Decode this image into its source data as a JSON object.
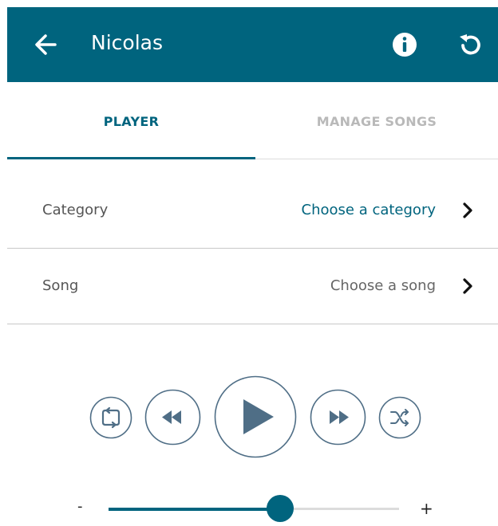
{
  "header": {
    "title": "Nicolas",
    "back_icon": "arrow-left-icon",
    "info_icon": "info-icon",
    "refresh_icon": "refresh-icon"
  },
  "tabs": [
    {
      "label": "PLAYER",
      "active": true
    },
    {
      "label": "MANAGE SONGS",
      "active": false
    }
  ],
  "rows": {
    "category": {
      "label": "Category",
      "value": "Choose a category"
    },
    "song": {
      "label": "Song",
      "value": "Choose a song"
    }
  },
  "controls": {
    "repeat_icon": "repeat-icon",
    "rewind_icon": "rewind-icon",
    "play_icon": "play-icon",
    "forward_icon": "fast-forward-icon",
    "shuffle_icon": "shuffle-icon"
  },
  "volume": {
    "minus_label": "-",
    "plus_label": "+",
    "level": 0.59
  },
  "colors": {
    "primary": "#00647e",
    "control_stroke": "#4f6e86",
    "inactive_tab": "#b9b9b9"
  }
}
